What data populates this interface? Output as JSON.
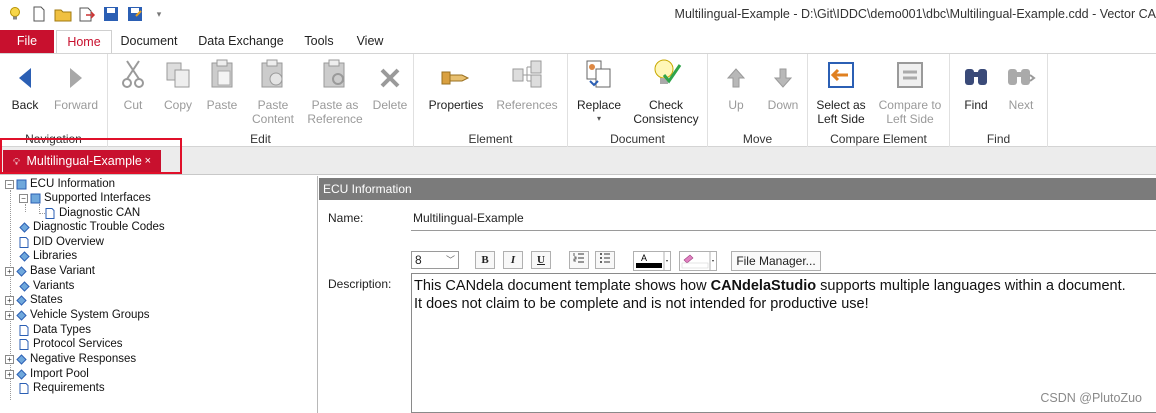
{
  "window": {
    "title": "Multilingual-Example - D:\\Git\\IDDC\\demo001\\dbc\\Multilingual-Example.cdd - Vector CA",
    "quick_access_icons": [
      "bulb-icon",
      "new-document-icon",
      "open-folder-icon",
      "import-icon",
      "save-icon",
      "save-as-icon",
      "customize-dropdown-icon"
    ]
  },
  "ribbon_tabs": {
    "file": "File",
    "home": "Home",
    "document": "Document",
    "data_exchange": "Data Exchange",
    "tools": "Tools",
    "view": "View"
  },
  "ribbon": {
    "navigation": {
      "label": "Navigation",
      "back": "Back",
      "forward": "Forward"
    },
    "edit": {
      "label": "Edit",
      "cut": "Cut",
      "copy": "Copy",
      "paste": "Paste",
      "paste_content_1": "Paste",
      "paste_content_2": "Content",
      "paste_ref_1": "Paste as",
      "paste_ref_2": "Reference",
      "delete": "Delete"
    },
    "element": {
      "label": "Element",
      "properties": "Properties",
      "references": "References"
    },
    "document": {
      "label": "Document",
      "replace": "Replace",
      "replace_arrow": "▾",
      "check_1": "Check",
      "check_2": "Consistency"
    },
    "move": {
      "label": "Move",
      "up": "Up",
      "down": "Down"
    },
    "compare": {
      "label": "Compare Element",
      "select_1": "Select as",
      "select_2": "Left Side",
      "compare_1": "Compare to",
      "compare_2": "Left Side"
    },
    "find": {
      "label": "Find",
      "find": "Find",
      "next": "Next"
    }
  },
  "doc_tab": {
    "label": "Multilingual-Example",
    "close": "×"
  },
  "tree": {
    "items": [
      "ECU Information",
      "Supported Interfaces",
      "Diagnostic CAN",
      "Diagnostic Trouble Codes",
      "DID Overview",
      "Libraries",
      "Base Variant",
      "Variants",
      "States",
      "Vehicle System Groups",
      "Data Types",
      "Protocol Services",
      "Negative Responses",
      "Import Pool",
      "Requirements"
    ]
  },
  "detail": {
    "header": "ECU Information",
    "name_label": "Name:",
    "name_value": "Multilingual-Example",
    "description_label": "Description:",
    "font_size": "8",
    "bold": "B",
    "italic": "I",
    "underline": "U",
    "file_manager": "File Manager...",
    "desc_pre": "This CANdela document template shows how ",
    "desc_bold": "CANdelaStudio",
    "desc_post": " supports multiple languages within a document.",
    "desc_line2": "It does not claim to be complete and is not intended for productive use!"
  },
  "watermark": "CSDN @PlutoZuo",
  "colors": {
    "accent": "#c8102e",
    "header_gray": "#7b7b7b",
    "highlight": "#e0102a"
  }
}
